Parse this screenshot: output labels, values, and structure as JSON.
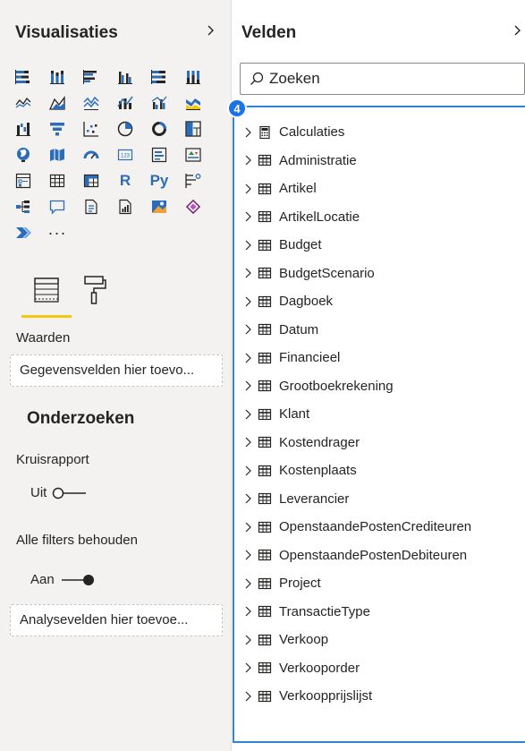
{
  "viz_pane": {
    "title": "Visualisaties",
    "collapse_icon": "chevron-right-icon",
    "visuals": [
      "stacked-bar-chart-icon",
      "stacked-column-chart-icon",
      "clustered-bar-chart-icon",
      "clustered-column-chart-icon",
      "100-stacked-bar-chart-icon",
      "100-stacked-column-chart-icon",
      "line-chart-icon",
      "area-chart-icon",
      "stacked-area-chart-icon",
      "line-and-stacked-column-chart-icon",
      "line-and-clustered-column-chart-icon",
      "ribbon-chart-icon",
      "waterfall-chart-icon",
      "funnel-chart-icon",
      "scatter-chart-icon",
      "pie-chart-icon",
      "donut-chart-icon",
      "treemap-icon",
      "map-icon",
      "filled-map-icon",
      "gauge-icon",
      "card-icon",
      "multi-row-card-icon",
      "kpi-icon",
      "slicer-icon",
      "table-icon",
      "matrix-icon",
      "r-visual-icon",
      "python-visual-icon",
      "key-influencers-icon",
      "decomposition-tree-icon",
      "qa-icon",
      "smart-narrative-icon",
      "paginated-report-icon",
      "azure-map-icon",
      "power-apps-icon",
      "power-automate-icon",
      "more-visuals-icon"
    ],
    "r_label": "R",
    "py_label": "Py",
    "more_label": "···",
    "tabs": {
      "fields_icon": "fields-well-icon",
      "format_icon": "format-paint-roller-icon"
    },
    "values_label": "Waarden",
    "values_placeholder": "Gegevensvelden hier toevo...",
    "drillthrough_title": "Onderzoeken",
    "cross_report_label": "Kruisrapport",
    "cross_report_state": "Uit",
    "keep_filters_label": "Alle filters behouden",
    "keep_filters_state": "Aan",
    "drillthrough_placeholder": "Analysevelden hier toevoe..."
  },
  "fields_pane": {
    "title": "Velden",
    "collapse_icon": "chevron-right-icon",
    "search_placeholder": "Zoeken",
    "step_badge": "4",
    "tables": [
      {
        "name": "Calculaties",
        "icon": "calculator-icon"
      },
      {
        "name": "Administratie",
        "icon": "table-icon"
      },
      {
        "name": "Artikel",
        "icon": "table-icon"
      },
      {
        "name": "ArtikelLocatie",
        "icon": "table-icon"
      },
      {
        "name": "Budget",
        "icon": "table-icon"
      },
      {
        "name": "BudgetScenario",
        "icon": "table-icon"
      },
      {
        "name": "Dagboek",
        "icon": "table-icon"
      },
      {
        "name": "Datum",
        "icon": "table-icon"
      },
      {
        "name": "Financieel",
        "icon": "table-icon"
      },
      {
        "name": "Grootboekrekening",
        "icon": "table-icon"
      },
      {
        "name": "Klant",
        "icon": "table-icon"
      },
      {
        "name": "Kostendrager",
        "icon": "table-icon"
      },
      {
        "name": "Kostenplaats",
        "icon": "table-icon"
      },
      {
        "name": "Leverancier",
        "icon": "table-icon"
      },
      {
        "name": "OpenstaandePostenCrediteuren",
        "icon": "table-icon"
      },
      {
        "name": "OpenstaandePostenDebiteuren",
        "icon": "table-icon"
      },
      {
        "name": "Project",
        "icon": "table-icon"
      },
      {
        "name": "TransactieType",
        "icon": "table-icon"
      },
      {
        "name": "Verkoop",
        "icon": "table-icon"
      },
      {
        "name": "Verkooporder",
        "icon": "table-icon"
      },
      {
        "name": "Verkoopprijslijst",
        "icon": "table-icon"
      }
    ]
  },
  "colors": {
    "accent_yellow": "#f2c811",
    "highlight_blue": "#2f85d7",
    "badge_blue": "#1a73e8",
    "icon_blue": "#2b6db7"
  }
}
